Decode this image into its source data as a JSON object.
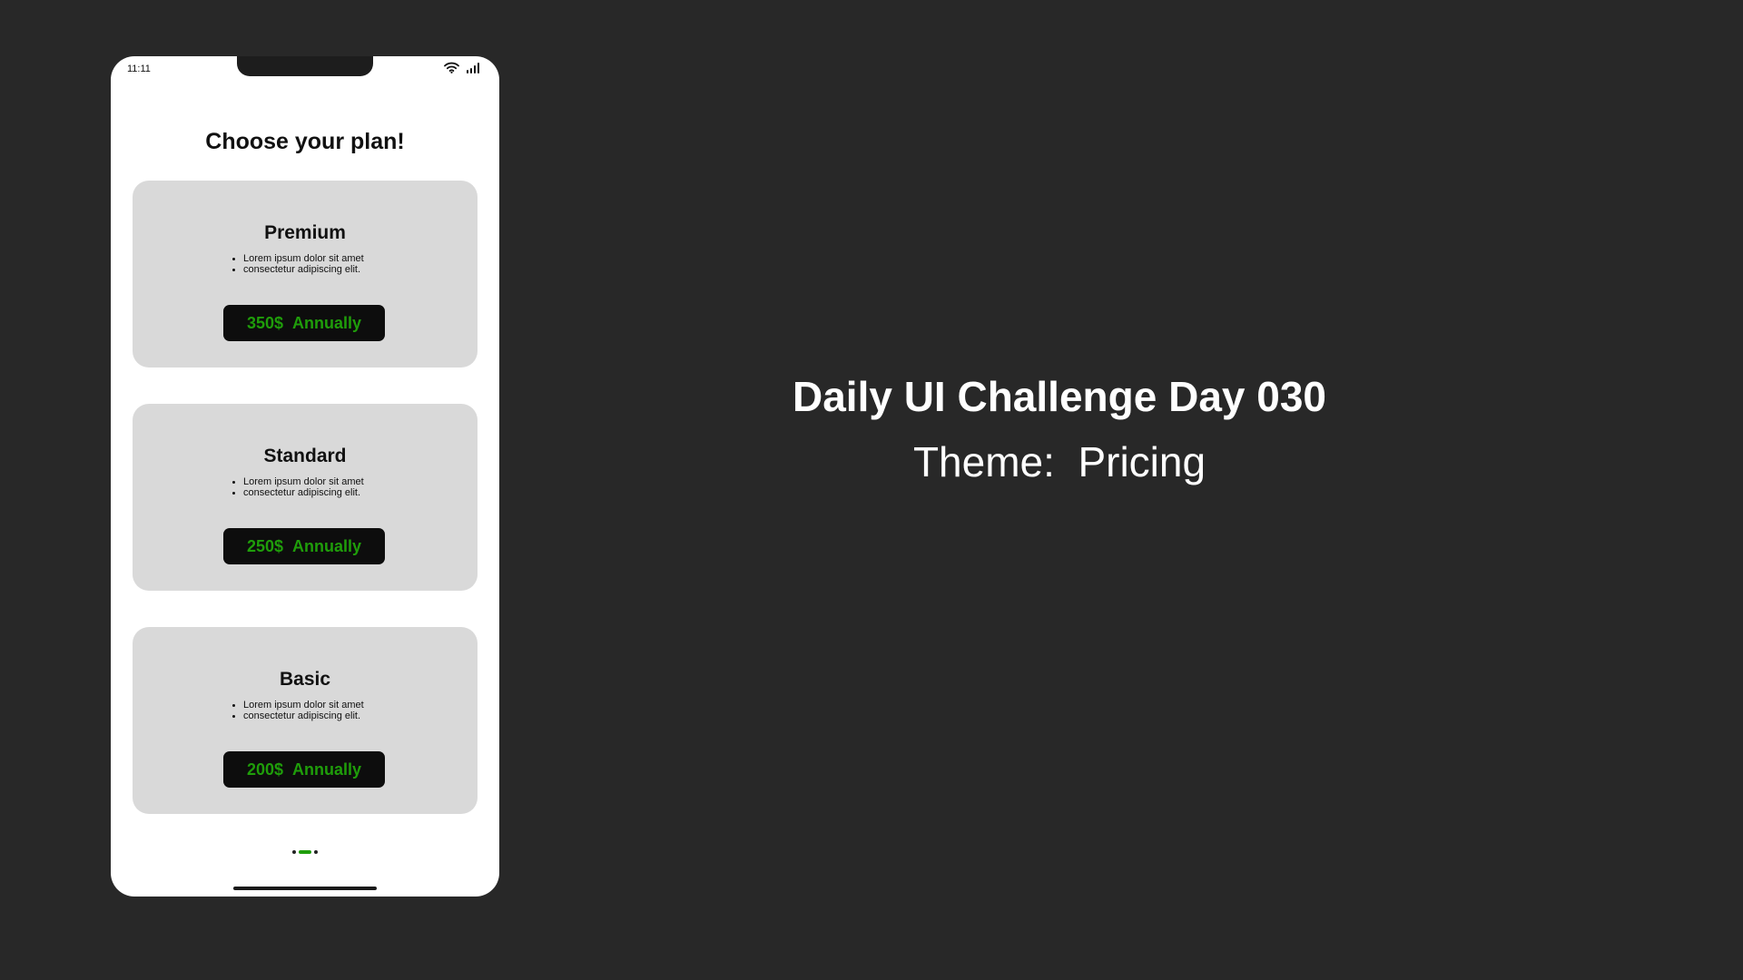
{
  "status_bar": {
    "time": "11:11",
    "wifi_icon": "wifi-icon",
    "signal_icon": "cellular-signal-icon"
  },
  "screen": {
    "title": "Choose your plan!"
  },
  "plans": [
    {
      "name": "Premium",
      "features": [
        "Lorem ipsum dolor sit amet",
        "consectetur adipiscing elit."
      ],
      "price": "350$",
      "period": "Annually"
    },
    {
      "name": "Standard",
      "features": [
        "Lorem ipsum dolor sit amet",
        "consectetur adipiscing elit."
      ],
      "price": "250$",
      "period": "Annually"
    },
    {
      "name": "Basic",
      "features": [
        "Lorem ipsum dolor sit amet",
        "consectetur adipiscing elit."
      ],
      "price": "200$",
      "period": "Annually"
    }
  ],
  "pager": {
    "current": 2,
    "total": 3
  },
  "showcase": {
    "title": "Daily UI Challenge Day 030",
    "theme": "Theme:  Pricing"
  },
  "colors": {
    "background": "#282828",
    "card": "#d9d9d9",
    "button": "#0d0d0d",
    "accent_green": "#1f9d0a"
  }
}
